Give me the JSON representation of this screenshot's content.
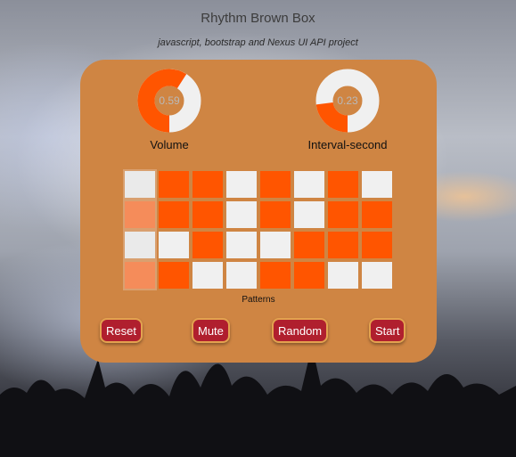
{
  "header": {
    "title": "Rhythm Brown Box",
    "subtitle": "javascript, bootstrap and Nexus UI API project"
  },
  "dials": [
    {
      "value": "0.59",
      "label": "Volume",
      "fraction": 0.59
    },
    {
      "value": "0.23",
      "label": "Interval-second",
      "fraction": 0.23
    }
  ],
  "sequencer": {
    "label": "Patterns",
    "current_column": 0,
    "rows": [
      [
        0,
        1,
        1,
        0,
        1,
        0,
        1,
        0
      ],
      [
        1,
        1,
        1,
        0,
        1,
        0,
        1,
        1
      ],
      [
        0,
        0,
        1,
        0,
        0,
        1,
        1,
        1
      ],
      [
        1,
        1,
        0,
        0,
        1,
        1,
        0,
        0
      ]
    ]
  },
  "buttons": {
    "reset": "Reset",
    "mute": "Mute",
    "random": "Random",
    "start": "Start"
  },
  "colors": {
    "panel": "#cf8543",
    "accent": "#ff5500",
    "button": "#b01f2e"
  }
}
